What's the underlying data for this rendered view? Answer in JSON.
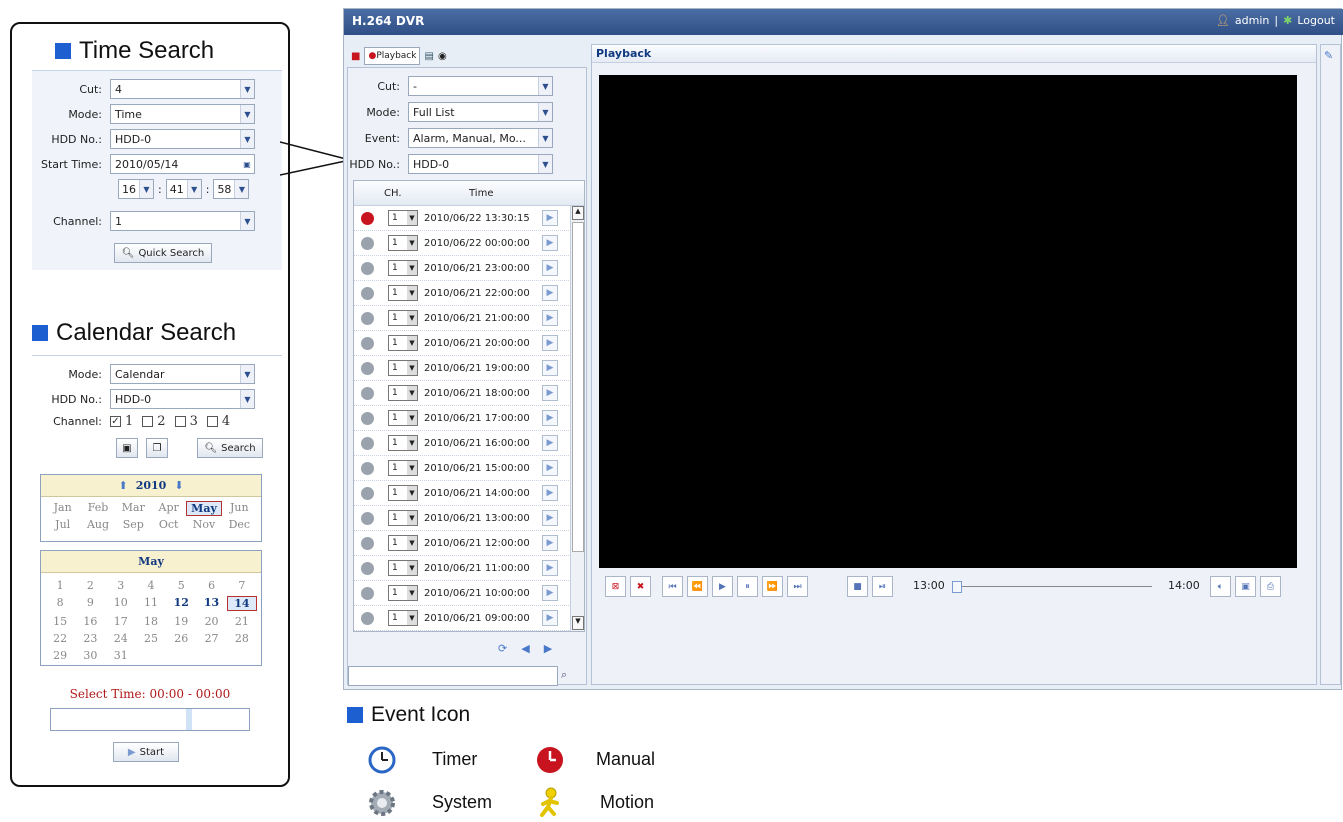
{
  "time_search": {
    "title": "Time Search",
    "cut_label": "Cut:",
    "cut_value": "4",
    "mode_label": "Mode:",
    "mode_value": "Time",
    "hdd_label": "HDD No.:",
    "hdd_value": "HDD-0",
    "start_label": "Start Time:",
    "start_date": "2010/05/14",
    "hour": "16",
    "minute": "41",
    "second": "58",
    "sep": ":",
    "channel_label": "Channel:",
    "channel_value": "1",
    "quick_search": "Quick Search"
  },
  "calendar_search": {
    "title": "Calendar Search",
    "mode_label": "Mode:",
    "mode_value": "Calendar",
    "hdd_label": "HDD No.:",
    "hdd_value": "HDD-0",
    "channel_label": "Channel:",
    "channels": [
      "1",
      "2",
      "3",
      "4"
    ],
    "search": "Search",
    "year": "2010",
    "months": [
      "Jan",
      "Feb",
      "Mar",
      "Apr",
      "May",
      "Jun",
      "Jul",
      "Aug",
      "Sep",
      "Oct",
      "Nov",
      "Dec"
    ],
    "selected_month": "May",
    "month_title": "May",
    "days": [
      "1",
      "2",
      "3",
      "4",
      "5",
      "6",
      "7",
      "8",
      "9",
      "10",
      "11",
      "12",
      "13",
      "14",
      "15",
      "16",
      "17",
      "18",
      "19",
      "20",
      "21",
      "22",
      "23",
      "24",
      "25",
      "26",
      "27",
      "28",
      "29",
      "30",
      "31"
    ],
    "bold_days": [
      "12",
      "13"
    ],
    "selected_day": "14",
    "select_time": "Select Time: 00:00 - 00:00",
    "start": "Start"
  },
  "dvr": {
    "title": "H.264 DVR",
    "user": "admin",
    "divider": "|",
    "logout": "Logout",
    "playback_tab": "Playback",
    "cut_label": "Cut:",
    "cut_value": "-",
    "mode_label": "Mode:",
    "mode_value": "Full List",
    "event_label": "Event:",
    "event_value": "Alarm, Manual, Mo...",
    "hdd_label": "HDD No.:",
    "hdd_value": "HDD-0",
    "col_ch": "CH.",
    "col_time": "Time",
    "rows": [
      {
        "ch": "1",
        "time": "2010/06/22 13:30:15",
        "event": "manual"
      },
      {
        "ch": "1",
        "time": "2010/06/22 00:00:00",
        "event": "system"
      },
      {
        "ch": "1",
        "time": "2010/06/21 23:00:00",
        "event": "system"
      },
      {
        "ch": "1",
        "time": "2010/06/21 22:00:00",
        "event": "system"
      },
      {
        "ch": "1",
        "time": "2010/06/21 21:00:00",
        "event": "system"
      },
      {
        "ch": "1",
        "time": "2010/06/21 20:00:00",
        "event": "system"
      },
      {
        "ch": "1",
        "time": "2010/06/21 19:00:00",
        "event": "system"
      },
      {
        "ch": "1",
        "time": "2010/06/21 18:00:00",
        "event": "system"
      },
      {
        "ch": "1",
        "time": "2010/06/21 17:00:00",
        "event": "system"
      },
      {
        "ch": "1",
        "time": "2010/06/21 16:00:00",
        "event": "system"
      },
      {
        "ch": "1",
        "time": "2010/06/21 15:00:00",
        "event": "system"
      },
      {
        "ch": "1",
        "time": "2010/06/21 14:00:00",
        "event": "system"
      },
      {
        "ch": "1",
        "time": "2010/06/21 13:00:00",
        "event": "system"
      },
      {
        "ch": "1",
        "time": "2010/06/21 12:00:00",
        "event": "system"
      },
      {
        "ch": "1",
        "time": "2010/06/21 11:00:00",
        "event": "system"
      },
      {
        "ch": "1",
        "time": "2010/06/21 10:00:00",
        "event": "system"
      },
      {
        "ch": "1",
        "time": "2010/06/21 09:00:00",
        "event": "system"
      }
    ],
    "panel_title": "Playback",
    "time_start": "13:00",
    "time_end": "14:00"
  },
  "legend": {
    "title": "Event Icon",
    "timer": "Timer",
    "manual": "Manual",
    "system": "System",
    "motion": "Motion"
  },
  "colors": {
    "accent": "#1d5fd1",
    "titlebar": "#2f4f86",
    "manual": "#c8141e",
    "system": "#9aa3ad",
    "motion": "#f0d000"
  }
}
